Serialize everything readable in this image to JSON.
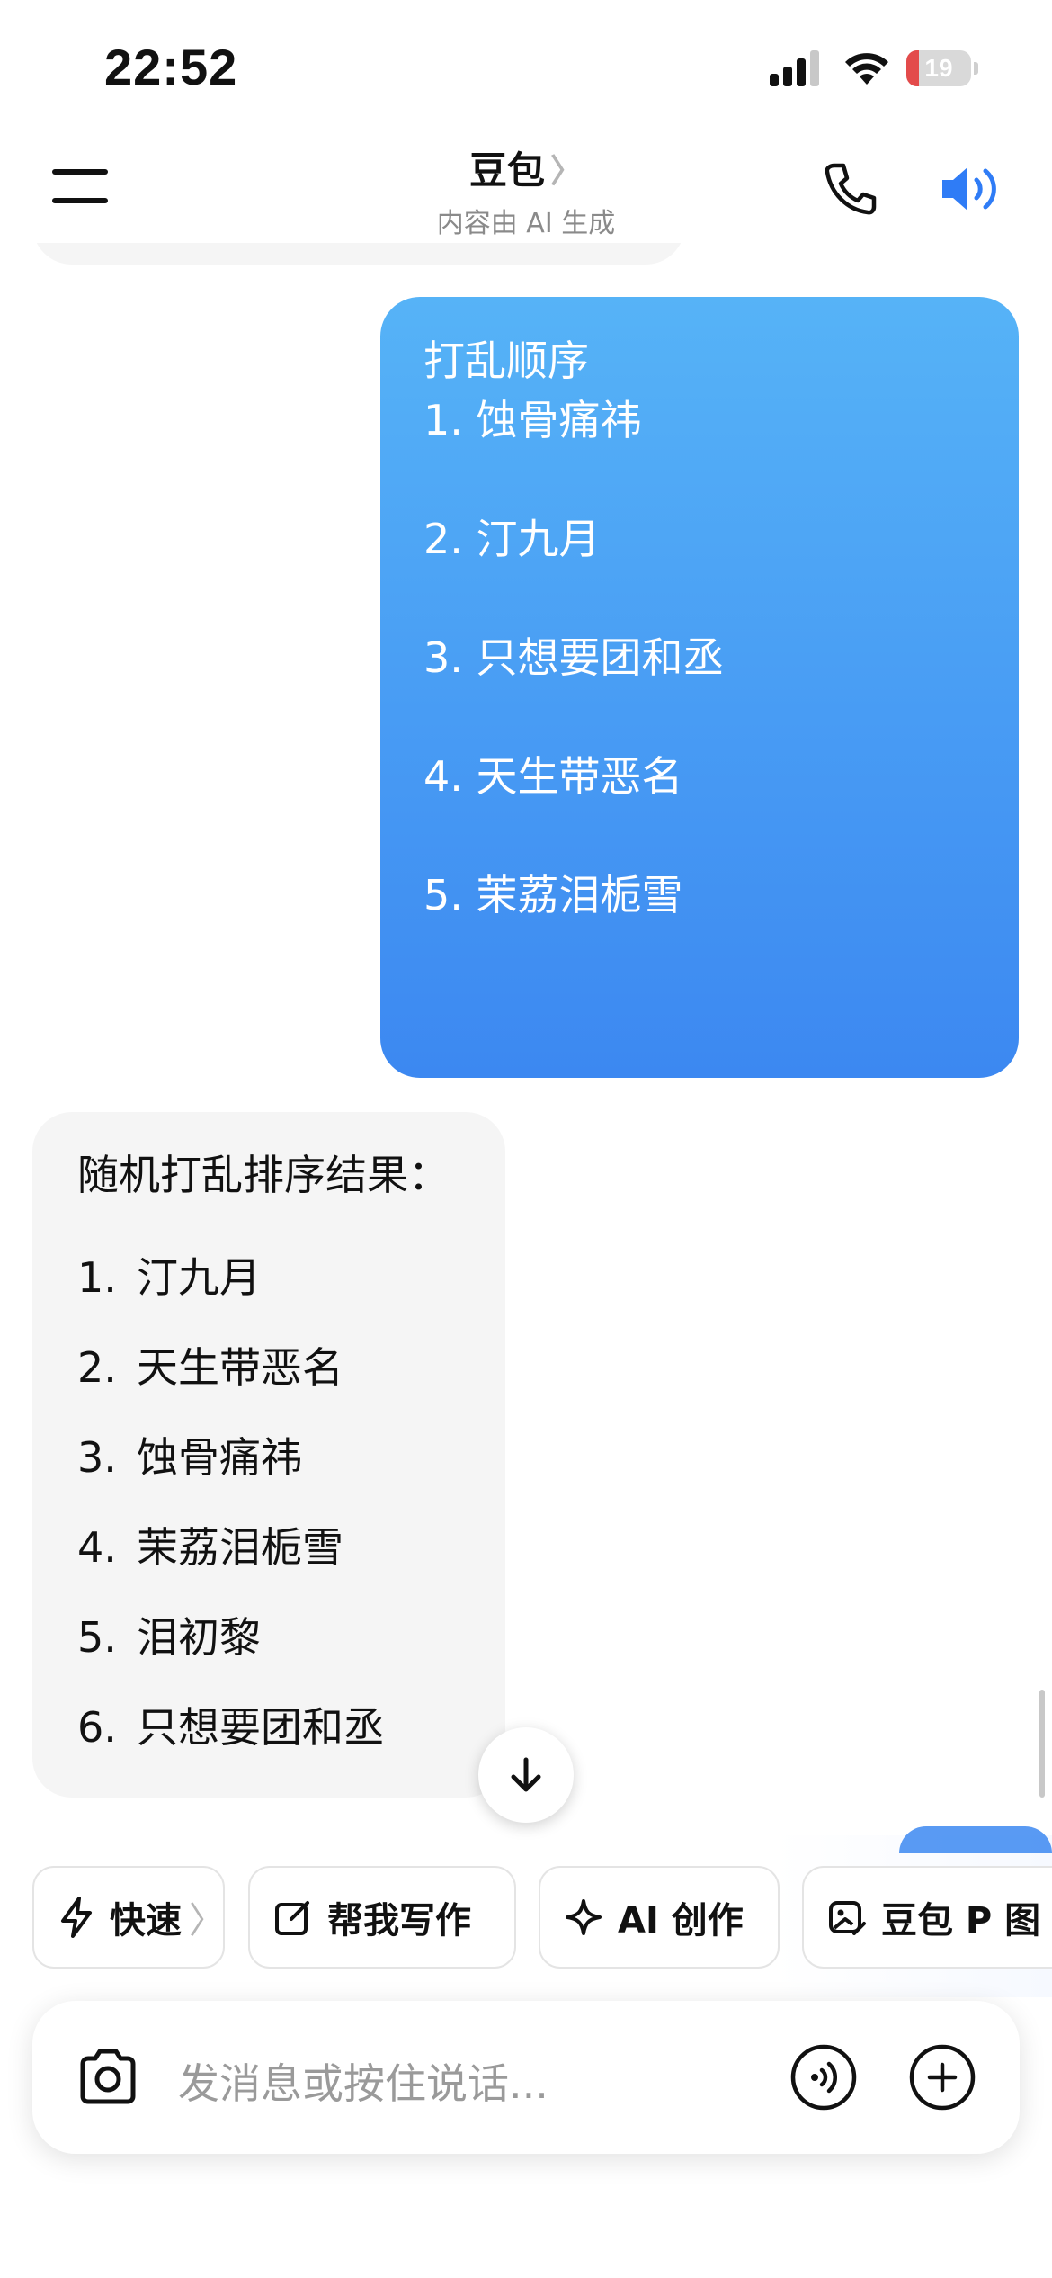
{
  "status_bar": {
    "time": "22:52",
    "battery": "19",
    "battery_level": 0.19,
    "icons": [
      "signal-icon",
      "wifi-icon",
      "battery-icon"
    ]
  },
  "header": {
    "title": "豆包",
    "title_chevron": "〉",
    "subtitle": "内容由 AI 生成",
    "icons": [
      "menu-icon",
      "phone-icon",
      "speaker-icon"
    ],
    "accent_color": "#2f7cf6"
  },
  "messages": {
    "user": {
      "heading": "打乱顺序",
      "items": [
        "1. 蚀骨痛祎",
        "2. 汀九月",
        "3. 只想要团和丞",
        "4. 天生带恶名",
        "5. 茉荔泪栀雪"
      ],
      "bubble_gradient": [
        "#56b3f7",
        "#3c88f1"
      ]
    },
    "bot": {
      "heading": "随机打乱排序结果：",
      "items": [
        {
          "num": "1.",
          "text": "汀九月"
        },
        {
          "num": "2.",
          "text": "天生带恶名"
        },
        {
          "num": "3.",
          "text": "蚀骨痛祎"
        },
        {
          "num": "4.",
          "text": "茉荔泪栀雪"
        },
        {
          "num": "5.",
          "text": "泪初黎"
        },
        {
          "num": "6.",
          "text": "只想要团和丞"
        }
      ]
    }
  },
  "scroll_button": {
    "icon": "arrow-down-icon"
  },
  "chips": [
    {
      "label": "快速",
      "icon": "lightning-icon",
      "chevron": "〉"
    },
    {
      "label": "帮我写作",
      "icon": "edit-icon"
    },
    {
      "label": "AI 创作",
      "icon": "sparkle-icon"
    },
    {
      "label": "豆包 P 图",
      "icon": "image-edit-icon"
    }
  ],
  "input": {
    "placeholder": "发消息或按住说话...",
    "icons": [
      "camera-icon",
      "voice-icon",
      "plus-icon"
    ]
  }
}
